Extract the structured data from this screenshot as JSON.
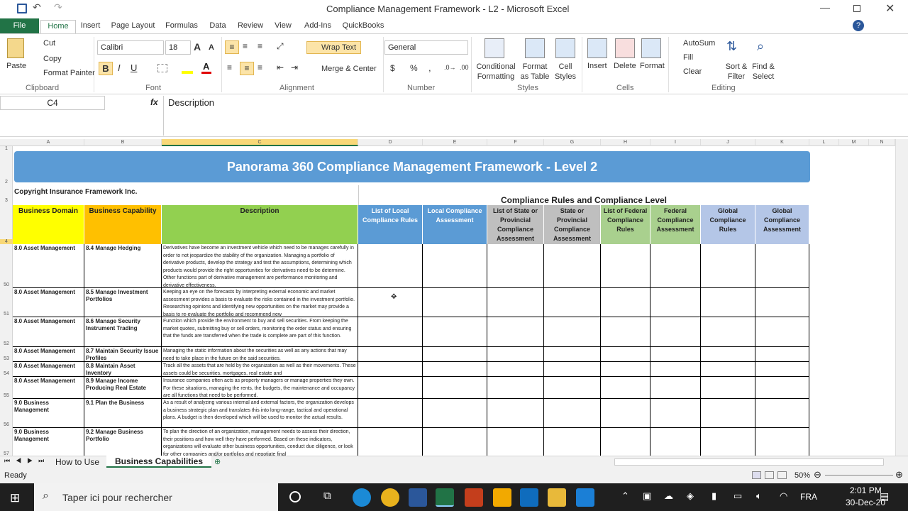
{
  "window": {
    "title": "Compliance Management Framework - L2  -  Microsoft Excel"
  },
  "tabs": [
    "File",
    "Home",
    "Insert",
    "Page Layout",
    "Formulas",
    "Data",
    "Review",
    "View",
    "Add-Ins",
    "QuickBooks"
  ],
  "clipboard": {
    "paste": "Paste",
    "cut": "Cut",
    "copy": "Copy",
    "format_painter": "Format Painter",
    "group": "Clipboard"
  },
  "font": {
    "name": "Calibri",
    "size": "18",
    "group": "Font"
  },
  "alignment": {
    "wrap": "Wrap Text",
    "merge": "Merge & Center",
    "group": "Alignment"
  },
  "number": {
    "format": "General",
    "group": "Number"
  },
  "styles": {
    "conditional": "Conditional Formatting",
    "format_table": "Format as Table",
    "cell_styles": "Cell Styles",
    "group": "Styles"
  },
  "cells": {
    "insert": "Insert",
    "delete": "Delete",
    "format": "Format",
    "group": "Cells"
  },
  "editing": {
    "autosum": "AutoSum",
    "fill": "Fill",
    "clear": "Clear",
    "sort": "Sort & Filter",
    "find": "Find & Select",
    "group": "Editing"
  },
  "formula_bar": {
    "name_box": "C4",
    "fx": "fx",
    "content": "Description"
  },
  "columns": [
    "A",
    "B",
    "C",
    "D",
    "E",
    "F",
    "G",
    "H",
    "I",
    "J",
    "K",
    "L",
    "M",
    "N"
  ],
  "rows": [
    "1",
    "2",
    "3",
    "4",
    "50",
    "51",
    "52",
    "53",
    "54",
    "55",
    "56",
    "57"
  ],
  "sheet": {
    "banner": "Panorama 360 Compliance Management Framework - Level 2",
    "copyright": "Copyright Insurance Framework Inc.",
    "group_header": "Compliance Rules and Compliance Level",
    "headers": [
      "Business Domain",
      "Business Capability",
      "Description",
      "List of Local Compliance Rules",
      "Local Compliance Assessment",
      "List of State or Provincial Compliance Assessment",
      "State or Provincial Compliance Assessment",
      "List of Federal Compliance Rules",
      "Federal Compliance Assessment",
      "Global Compliance Rules",
      "Global Compliance Assessment"
    ],
    "data_rows": [
      {
        "domain": "8.0 Asset Management",
        "capability": "8.4 Manage Hedging",
        "desc": "Derivatives have become an investment vehicle which need to be manages carefully in order to not jeopardize the stability of the organization. Managing a portfolio of derivative products, develop the strategy and test the assumptions, determining which products would provide the right opportunities for derivatives need to be determine. Other functions part of derivative management are performance monitoring and derivative effectiveness."
      },
      {
        "domain": "8.0 Asset Management",
        "capability": "8.5 Manage Investment Portfolios",
        "desc": "Keeping an eye on the forecasts by interpreting external economic and market assessment provides a basis to evaluate the risks contained in the investment portfolio. Researching opinions and identifying new opportunities on the market may provide a basis to re-evaluate the portfolio and recommend new"
      },
      {
        "domain": "8.0 Asset Management",
        "capability": "8.6 Manage Security Instrument Trading",
        "desc": "Function which provide the environment to buy and sell securities. From keeping the market quotes, submitting buy or sell orders, monitoring the order status and ensuring that the funds are transferred when the trade is complete are part of this function."
      },
      {
        "domain": "8.0 Asset Management",
        "capability": "8.7 Maintain Security Issue Profiles",
        "desc": "Managing the static information about the securities as well as any actions that may need to take place in the future on the said securities."
      },
      {
        "domain": "8.0 Asset Management",
        "capability": "8.8 Maintain Asset Inventory",
        "desc": "Track all the assets that are held by the organization as well as their movements. These assets could be securities, mortgages, real estate and"
      },
      {
        "domain": "8.0 Asset Management",
        "capability": "8.9 Manage Income Producing Real Estate",
        "desc": "Insurance companies often acts as property managers or manage properties they own. For these situations, managing the rents, the budgets, the maintenance and occupancy are all functions that need to be performed."
      },
      {
        "domain": "9.0 Business Management",
        "capability": "9.1 Plan the Business",
        "desc": "As a result of analyzing various internal and external factors, the organization develops a business strategic plan and translates this into long-range, tactical and operational plans. A budget is then developed which will be used to monitor the actual results."
      },
      {
        "domain": "9.0 Business Management",
        "capability": "9.2 Manage Business Portfolio",
        "desc": "To plan the direction of an organization, management needs to assess their direction, their positions and how well they have performed. Based on these indicators, organizations will evaluate other business opportunities, conduct due diligence, or look for other companies and/or portfolios and negotiate final"
      }
    ]
  },
  "sheet_tabs": [
    "How to Use",
    "Business Capabilities"
  ],
  "status": {
    "ready": "Ready",
    "zoom": "50%"
  },
  "taskbar": {
    "search": "Taper ici pour rechercher",
    "lang": "FRA",
    "time": "2:01 PM",
    "date": "30-Dec-20"
  },
  "colors": {
    "banner": "#5b9bd5",
    "yellow": "#ffff00",
    "orange": "#ffc000",
    "green": "#92d050",
    "lightblue": "#9bc2e6",
    "grey": "#bfbfbf",
    "lightgreen": "#a9d08e",
    "paleblue": "#b4c6e7"
  }
}
